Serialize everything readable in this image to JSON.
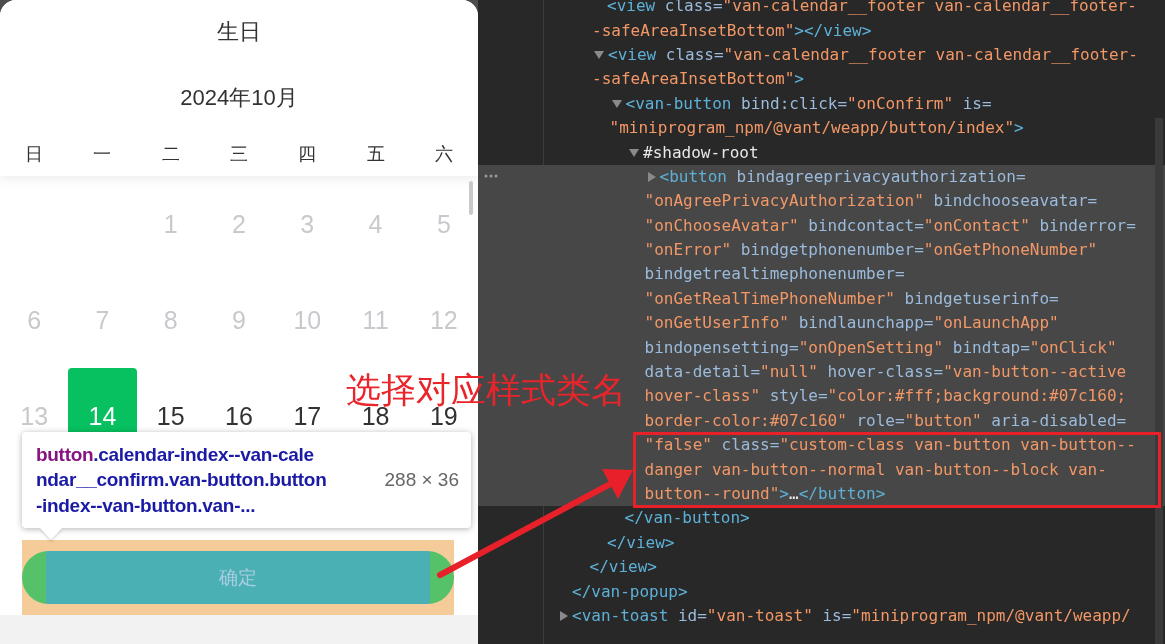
{
  "calendar": {
    "title": "生日",
    "month": "2024年10月",
    "weekdays": [
      "日",
      "一",
      "二",
      "三",
      "四",
      "五",
      "六"
    ],
    "weeks": [
      {
        "days": [
          {
            "label": "1",
            "disabled": true,
            "selected": false
          },
          {
            "label": "2",
            "disabled": true,
            "selected": false
          },
          {
            "label": "3",
            "disabled": true,
            "selected": false
          },
          {
            "label": "4",
            "disabled": true,
            "selected": false
          },
          {
            "label": "5",
            "disabled": true,
            "selected": false
          }
        ]
      },
      {
        "days": [
          {
            "label": "6",
            "disabled": true,
            "selected": false
          },
          {
            "label": "7",
            "disabled": true,
            "selected": false
          },
          {
            "label": "8",
            "disabled": true,
            "selected": false
          },
          {
            "label": "9",
            "disabled": true,
            "selected": false
          },
          {
            "label": "10",
            "disabled": true,
            "selected": false
          },
          {
            "label": "11",
            "disabled": true,
            "selected": false
          },
          {
            "label": "12",
            "disabled": true,
            "selected": false
          }
        ]
      },
      {
        "days": [
          {
            "label": "13",
            "disabled": true,
            "selected": false
          },
          {
            "label": "14",
            "disabled": false,
            "selected": true
          },
          {
            "label": "15",
            "disabled": false,
            "selected": false
          },
          {
            "label": "16",
            "disabled": false,
            "selected": false
          },
          {
            "label": "17",
            "disabled": false,
            "selected": false
          },
          {
            "label": "18",
            "disabled": false,
            "selected": false
          },
          {
            "label": "19",
            "disabled": false,
            "selected": false
          }
        ]
      }
    ],
    "confirm_button": {
      "label": "确定"
    }
  },
  "inspect_tooltip": {
    "tag": "button",
    "class_lines": [
      ".calendar-index--van-cale",
      "ndar__confirm.van-button.button",
      "-index--van-button.van-..."
    ],
    "size": "288 × 36"
  },
  "annotation": {
    "text": "选择对应样式类名"
  },
  "elements_tree": [
    {
      "children": [
        {
          "children": [
            {
              "selected": false,
              "lines": [
                [
                  {
                    "kind": "tag",
                    "text": "<view"
                  },
                  {
                    "kind": "attr",
                    "text": " class="
                  },
                  {
                    "kind": "value",
                    "text": "\"van-calendar__footer van-calendar__footer-"
                  }
                ],
                [
                  {
                    "kind": "value",
                    "text": "-safeAreaInsetBottom\""
                  },
                  {
                    "kind": "tag",
                    "text": "></view>"
                  }
                ]
              ]
            },
            {
              "selected": false,
              "expanded": true,
              "lines": [
                [
                  {
                    "kind": "tag",
                    "text": "<view"
                  },
                  {
                    "kind": "attr",
                    "text": " class="
                  },
                  {
                    "kind": "value",
                    "text": "\"van-calendar__footer van-calendar__footer-"
                  }
                ],
                [
                  {
                    "kind": "value",
                    "text": "-safeAreaInsetBottom\""
                  },
                  {
                    "kind": "tag",
                    "text": ">"
                  }
                ]
              ],
              "children": [
                {
                  "selected": false,
                  "expanded": true,
                  "lines": [
                    [
                      {
                        "kind": "tag",
                        "text": "<van-button"
                      },
                      {
                        "kind": "attr",
                        "text": " bind:click="
                      },
                      {
                        "kind": "value",
                        "text": "\"onConfirm\""
                      },
                      {
                        "kind": "attr",
                        "text": " is="
                      }
                    ],
                    [
                      {
                        "kind": "value",
                        "text": "\"miniprogram_npm/@vant/weapp/button/index\""
                      },
                      {
                        "kind": "tag",
                        "text": ">"
                      }
                    ]
                  ],
                  "children": [
                    {
                      "selected": false,
                      "expanded": true,
                      "lines": [
                        [
                          {
                            "kind": "text",
                            "text": "#shadow-root"
                          }
                        ]
                      ],
                      "children": [
                        {
                          "selected": true,
                          "expanded": false,
                          "lines": [
                            [
                              {
                                "kind": "tag",
                                "text": "<button"
                              },
                              {
                                "kind": "attr",
                                "text": " bindagreeprivacyauthorization="
                              }
                            ],
                            [
                              {
                                "kind": "value",
                                "text": "\"onAgreePrivacyAuthorization\""
                              },
                              {
                                "kind": "attr",
                                "text": " bindchooseavatar="
                              }
                            ],
                            [
                              {
                                "kind": "value",
                                "text": "\"onChooseAvatar\""
                              },
                              {
                                "kind": "attr",
                                "text": " bindcontact="
                              },
                              {
                                "kind": "value",
                                "text": "\"onContact\""
                              },
                              {
                                "kind": "attr",
                                "text": " binderror="
                              }
                            ],
                            [
                              {
                                "kind": "value",
                                "text": "\"onError\""
                              },
                              {
                                "kind": "attr",
                                "text": " bindgetphonenumber="
                              },
                              {
                                "kind": "value",
                                "text": "\"onGetPhoneNumber\""
                              }
                            ],
                            [
                              {
                                "kind": "attr",
                                "text": "bindgetrealtimephonenumber="
                              }
                            ],
                            [
                              {
                                "kind": "value",
                                "text": "\"onGetRealTimePhoneNumber\""
                              },
                              {
                                "kind": "attr",
                                "text": " bindgetuserinfo="
                              }
                            ],
                            [
                              {
                                "kind": "value",
                                "text": "\"onGetUserInfo\""
                              },
                              {
                                "kind": "attr",
                                "text": " bindlaunchapp="
                              },
                              {
                                "kind": "value",
                                "text": "\"onLaunchApp\""
                              }
                            ],
                            [
                              {
                                "kind": "attr",
                                "text": "bindopensetting="
                              },
                              {
                                "kind": "value",
                                "text": "\"onOpenSetting\""
                              },
                              {
                                "kind": "attr",
                                "text": " bindtap="
                              },
                              {
                                "kind": "value",
                                "text": "\"onClick\""
                              }
                            ],
                            [
                              {
                                "kind": "attr",
                                "text": "data-detail="
                              },
                              {
                                "kind": "value",
                                "text": "\"null\""
                              },
                              {
                                "kind": "attr",
                                "text": " hover-class="
                              },
                              {
                                "kind": "value",
                                "text": "\"van-button--active"
                              }
                            ],
                            [
                              {
                                "kind": "value",
                                "text": "hover-class\""
                              },
                              {
                                "kind": "attr",
                                "text": " style="
                              },
                              {
                                "kind": "value",
                                "text": "\"color:#fff;background:#07c160;"
                              }
                            ],
                            [
                              {
                                "kind": "value",
                                "text": "border-color:#07c160\""
                              },
                              {
                                "kind": "attr",
                                "text": " role="
                              },
                              {
                                "kind": "value",
                                "text": "\"button\""
                              },
                              {
                                "kind": "attr",
                                "text": " aria-disabled="
                              }
                            ],
                            [
                              {
                                "kind": "value",
                                "text": "\"false\""
                              },
                              {
                                "kind": "attr",
                                "text": " class="
                              },
                              {
                                "kind": "value",
                                "text": "\"custom-class van-button van-button--"
                              }
                            ],
                            [
                              {
                                "kind": "value",
                                "text": "danger van-button--normal van-button--block van-"
                              }
                            ],
                            [
                              {
                                "kind": "value",
                                "text": "button--round\""
                              },
                              {
                                "kind": "tag",
                                "text": ">"
                              },
                              {
                                "kind": "text",
                                "text": "…"
                              },
                              {
                                "kind": "tag",
                                "text": "</button>"
                              }
                            ]
                          ]
                        }
                      ]
                    }
                  ],
                  "close": [
                    {
                      "kind": "tag",
                      "text": "</van-button>"
                    }
                  ]
                }
              ],
              "close": [
                {
                  "kind": "tag",
                  "text": "</view>"
                }
              ]
            }
          ],
          "close": [
            {
              "kind": "tag",
              "text": "</view>"
            }
          ]
        }
      ],
      "close": [
        {
          "kind": "tag",
          "text": "</van-popup>"
        }
      ]
    },
    {
      "selected": false,
      "expanded": false,
      "lines": [
        [
          {
            "kind": "tag",
            "text": "<van-toast"
          },
          {
            "kind": "attr",
            "text": " id="
          },
          {
            "kind": "value",
            "text": "\"van-toast\""
          },
          {
            "kind": "attr",
            "text": " is="
          },
          {
            "kind": "value",
            "text": "\"miniprogram_npm/@vant/weapp/"
          }
        ]
      ]
    }
  ]
}
